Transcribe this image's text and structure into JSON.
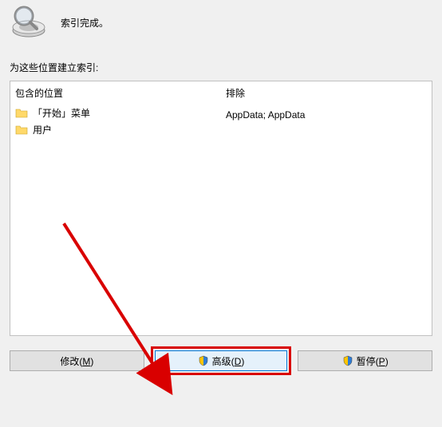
{
  "status": {
    "text": "索引完成。"
  },
  "section_label": "为这些位置建立索引:",
  "columns": {
    "included_header": "包含的位置",
    "excluded_header": "排除"
  },
  "locations": [
    {
      "name": "「开始」菜单",
      "exclude": ""
    },
    {
      "name": "用户",
      "exclude": "AppData; AppData"
    }
  ],
  "buttons": {
    "modify": {
      "label": "修改(",
      "key": "M",
      "suffix": ")"
    },
    "advanced": {
      "label": "高级(",
      "key": "D",
      "suffix": ")"
    },
    "pause": {
      "label": "暂停(",
      "key": "P",
      "suffix": ")"
    }
  }
}
